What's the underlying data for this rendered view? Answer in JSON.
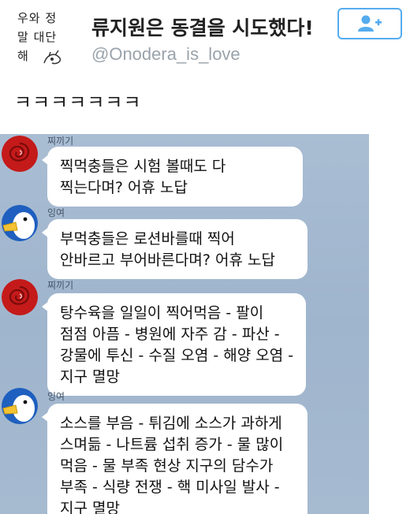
{
  "tweet": {
    "avatar": {
      "text_lines": [
        "우와 정",
        "말 대단",
        "해"
      ]
    },
    "display_name": "류지원은 동결을 시도했다!",
    "handle": "@Onodera_is_love",
    "follow_icon": "follow-user-plus-icon",
    "body": "ㅋㅋㅋㅋㅋㅋㅋ"
  },
  "chat": {
    "messages": [
      {
        "sender": "찌끼기",
        "avatar": "red-rose-avatar",
        "lines": [
          "찍먹충들은 시험 볼때도 다",
          "찍는다며? 어휴 노답"
        ]
      },
      {
        "sender": "잉여",
        "avatar": "duck-avatar",
        "lines": [
          "부먹충들은 로션바를때 찍어",
          "안바르고 부어바른다며? 어휴 노답"
        ]
      },
      {
        "sender": "찌끼기",
        "avatar": "red-rose-avatar",
        "lines": [
          "탕수육을 일일이 찍어먹음 - 팔이",
          "점점 아픔 - 병원에 자주 감 - 파산 -",
          "강물에 투신 - 수질 오염 - 해양 오염 -",
          "지구 멸망"
        ]
      },
      {
        "sender": "잉여",
        "avatar": "duck-avatar",
        "lines": [
          "소스를 부음 - 튀김에 소스가 과하게",
          "스며듦 - 나트륨 섭취 증가 - 물 많이",
          "먹음 - 물 부족 현상 지구의 담수가",
          "부족 - 식량 전쟁 - 핵 미사일 발사 -",
          "지구 멸망"
        ]
      }
    ]
  },
  "colors": {
    "chat_background": "#a6bad0",
    "bubble": "#ffffff",
    "follow_accent": "#55acee",
    "handle_gray": "#9aa3ab"
  }
}
